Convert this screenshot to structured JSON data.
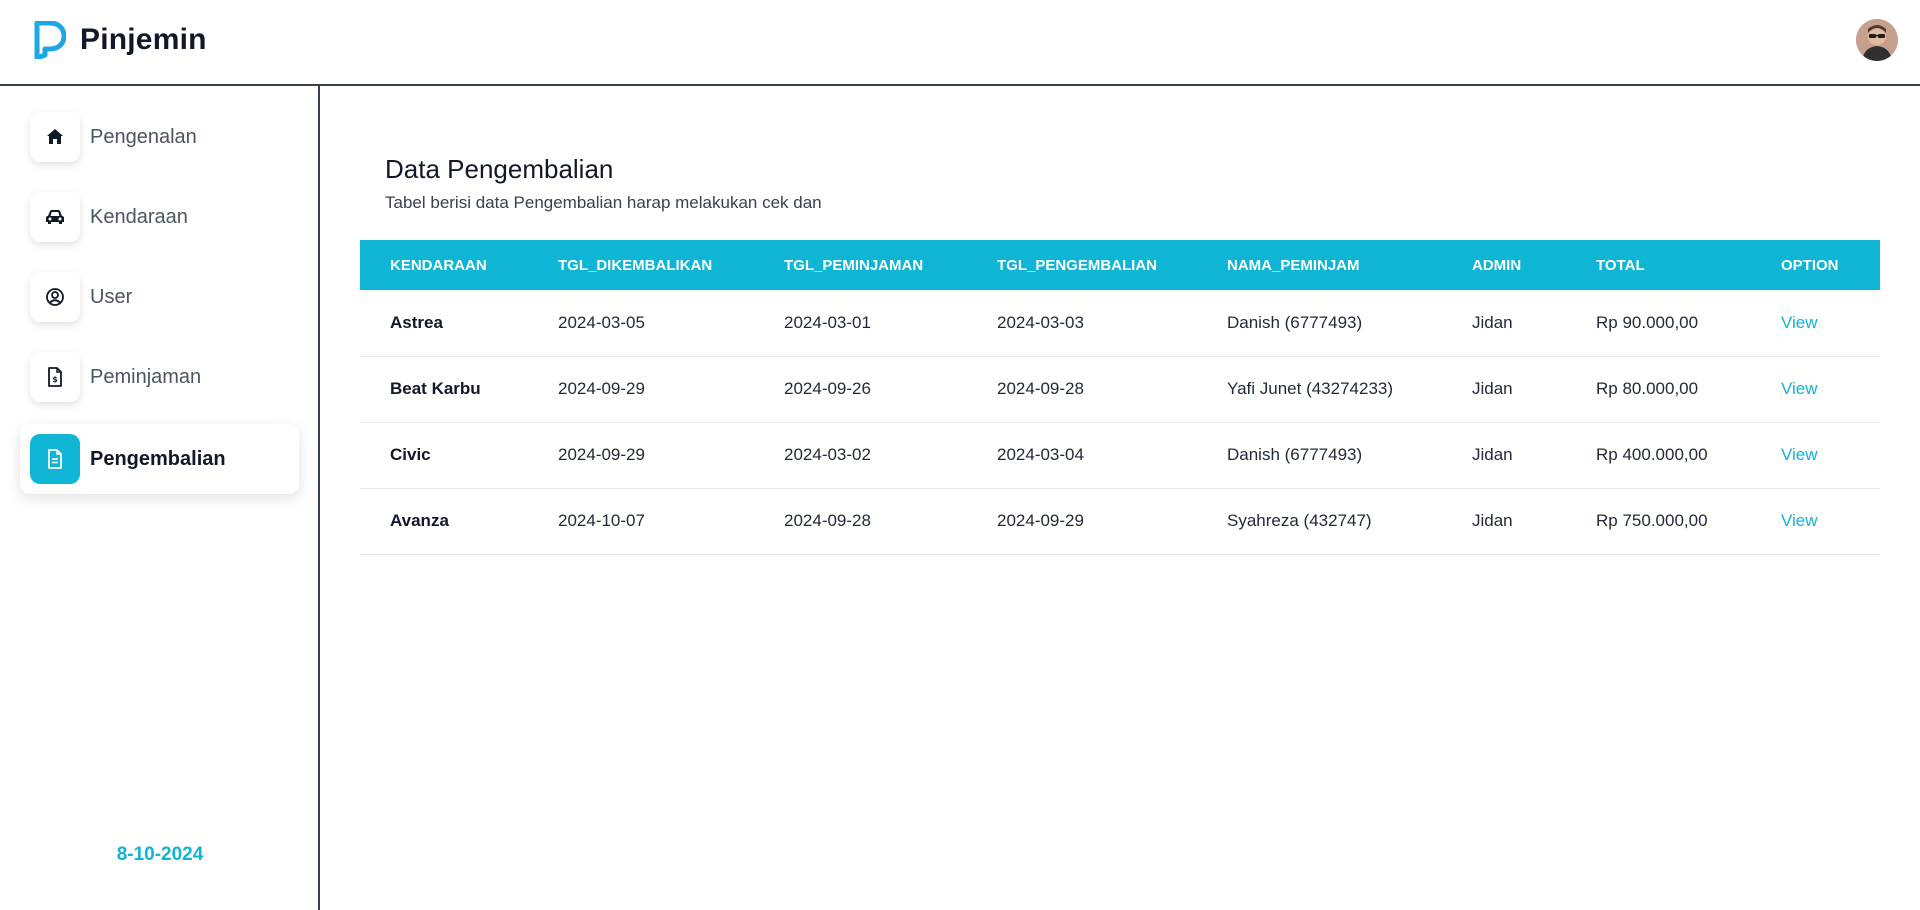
{
  "app": {
    "name": "Pinjemin"
  },
  "colors": {
    "accent": "#0fb5d4",
    "border": "#374151",
    "text_dark": "#111827"
  },
  "header": {
    "logo_icon": "p-logo-icon",
    "avatar_icon": "user-avatar"
  },
  "sidebar": {
    "items": [
      {
        "label": "Pengenalan",
        "icon": "home-icon",
        "active": false
      },
      {
        "label": "Kendaraan",
        "icon": "car-icon",
        "active": false
      },
      {
        "label": "User",
        "icon": "user-circle-icon",
        "active": false
      },
      {
        "label": "Peminjaman",
        "icon": "document-dollar-icon",
        "active": false
      },
      {
        "label": "Pengembalian",
        "icon": "document-text-icon",
        "active": true
      }
    ],
    "date": "8-10-2024"
  },
  "main": {
    "title": "Data Pengembalian",
    "subtitle": "Tabel berisi data Pengembalian harap melakukan cek dan"
  },
  "table": {
    "headers": [
      "KENDARAAN",
      "TGL_DIKEMBALIKAN",
      "TGL_PEMINJAMAN",
      "TGL_PENGEMBALIAN",
      "NAMA_PEMINJAM",
      "ADMIN",
      "TOTAL",
      "OPTION"
    ],
    "rows": [
      {
        "kendaraan": "Astrea",
        "tgl_dikembalikan": "2024-03-05",
        "tgl_peminjaman": "2024-03-01",
        "tgl_pengembalian": "2024-03-03",
        "nama_peminjam": "Danish (6777493)",
        "admin": "Jidan",
        "total": "Rp 90.000,00",
        "option": "View"
      },
      {
        "kendaraan": "Beat Karbu",
        "tgl_dikembalikan": "2024-09-29",
        "tgl_peminjaman": "2024-09-26",
        "tgl_pengembalian": "2024-09-28",
        "nama_peminjam": "Yafi Junet (43274233)",
        "admin": "Jidan",
        "total": "Rp 80.000,00",
        "option": "View"
      },
      {
        "kendaraan": "Civic",
        "tgl_dikembalikan": "2024-09-29",
        "tgl_peminjaman": "2024-03-02",
        "tgl_pengembalian": "2024-03-04",
        "nama_peminjam": "Danish (6777493)",
        "admin": "Jidan",
        "total": "Rp 400.000,00",
        "option": "View"
      },
      {
        "kendaraan": "Avanza",
        "tgl_dikembalikan": "2024-10-07",
        "tgl_peminjaman": "2024-09-28",
        "tgl_pengembalian": "2024-09-29",
        "nama_peminjam": "Syahreza (432747)",
        "admin": "Jidan",
        "total": "Rp 750.000,00",
        "option": "View"
      }
    ]
  }
}
